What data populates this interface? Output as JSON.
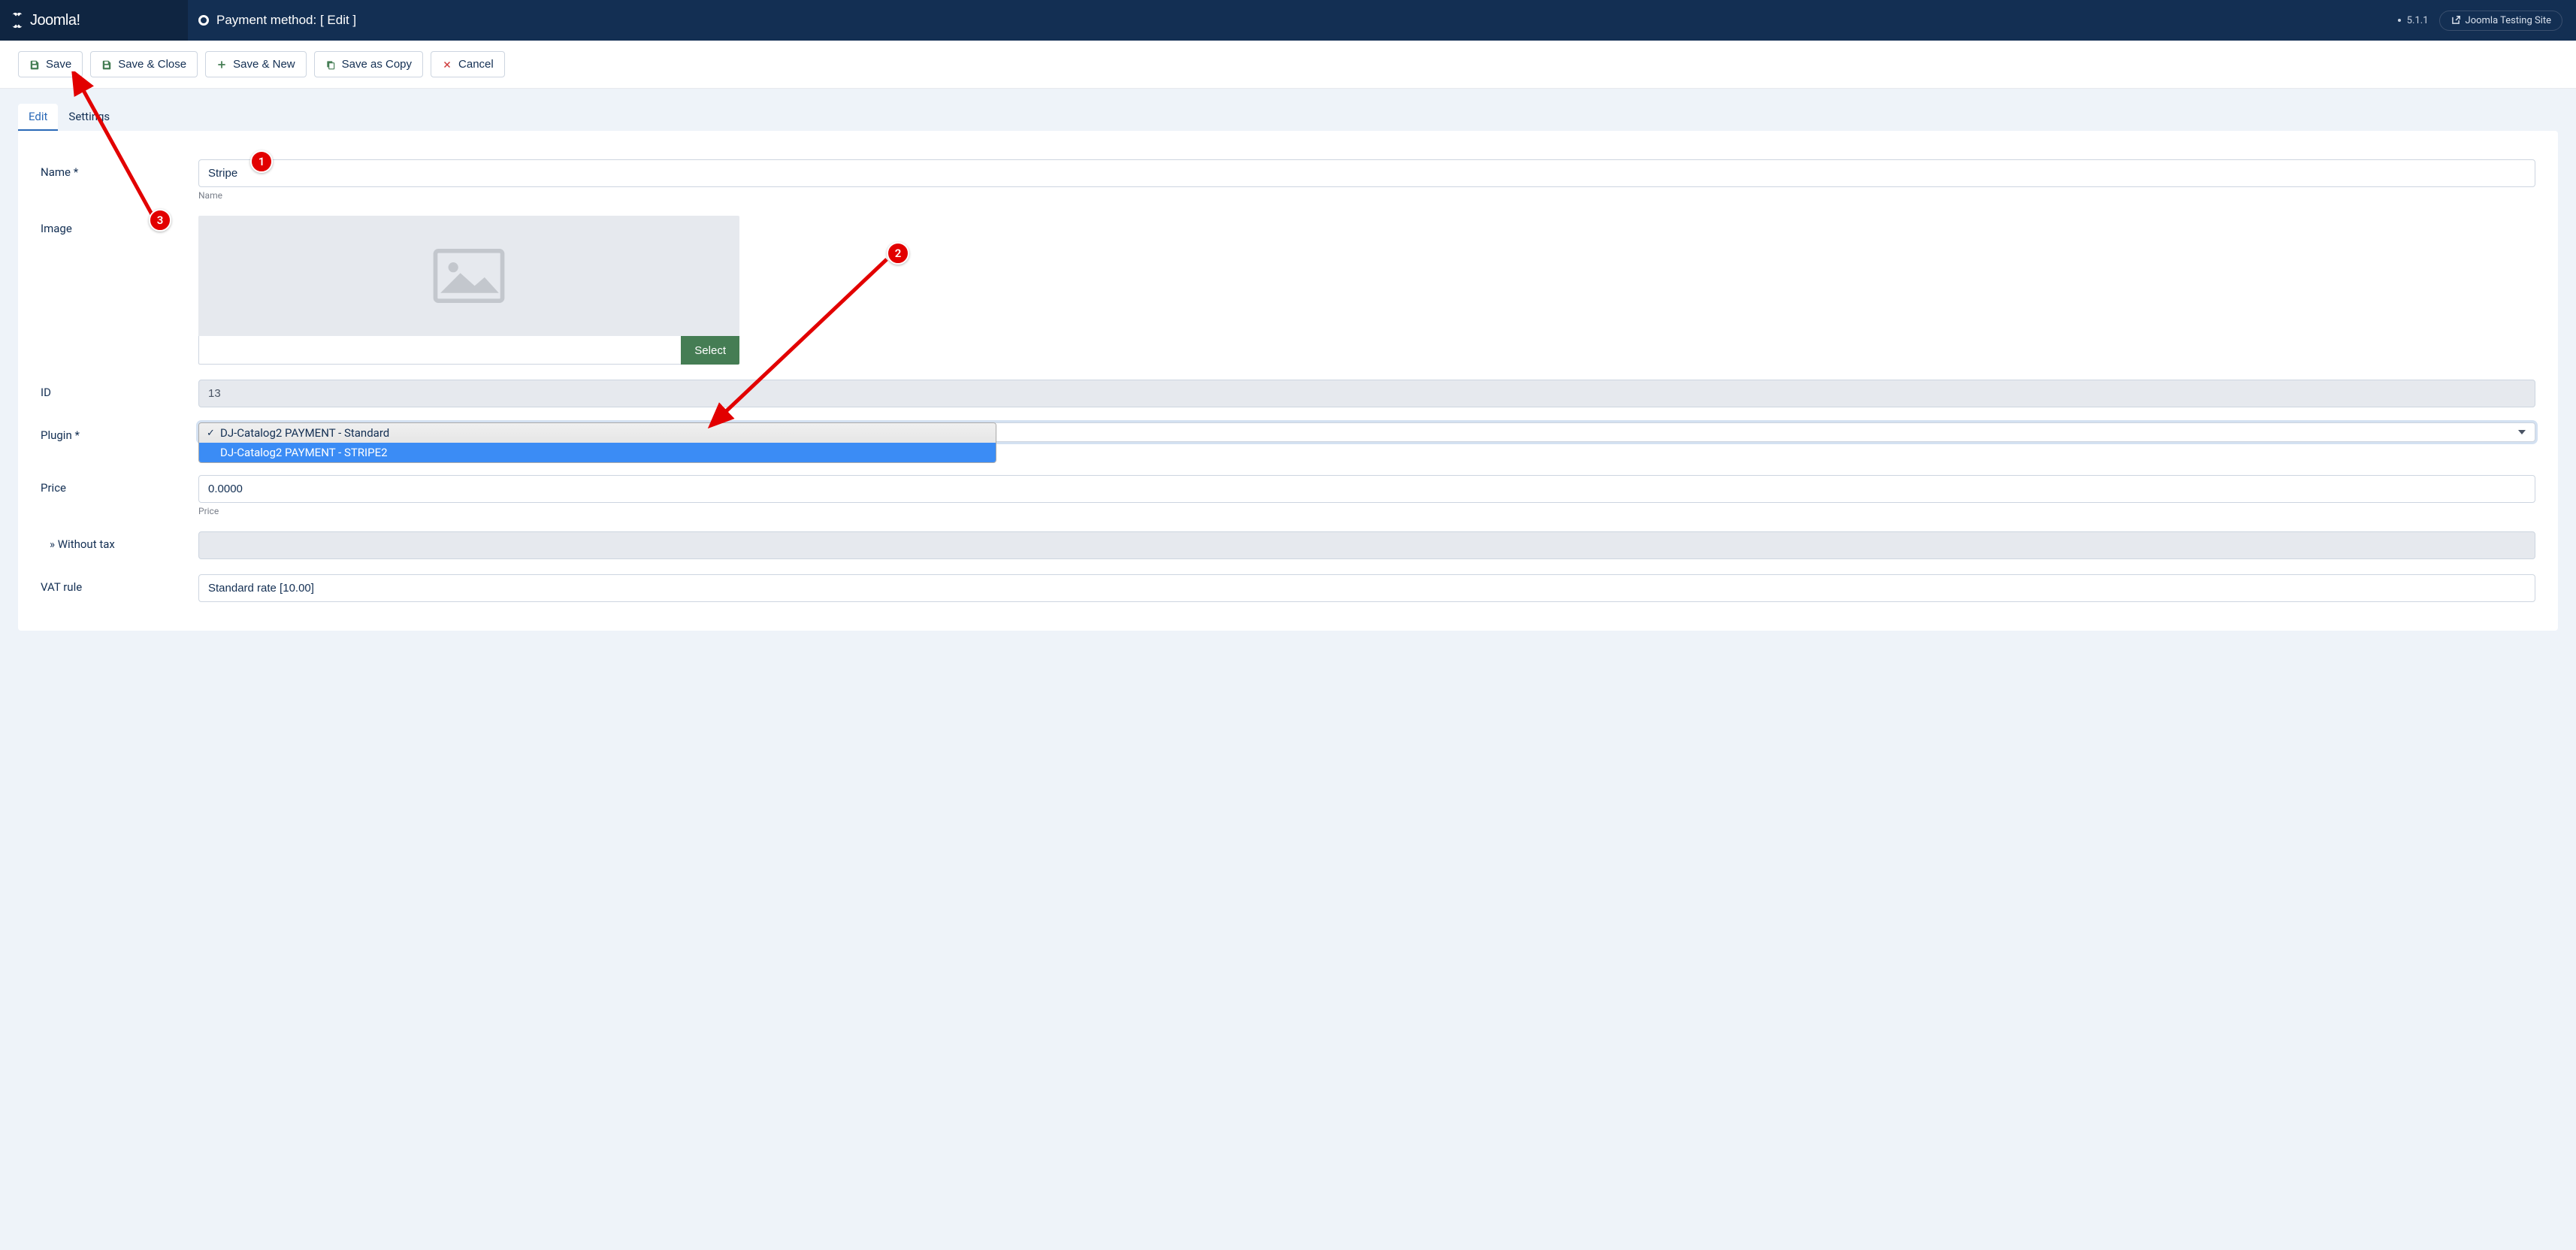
{
  "header": {
    "brand": "Joomla!",
    "page_title": "Payment method: [ Edit ]",
    "version": "5.1.1",
    "site_link_label": "Joomla Testing Site"
  },
  "toolbar": {
    "save": "Save",
    "save_close": "Save & Close",
    "save_new": "Save & New",
    "save_copy": "Save as Copy",
    "cancel": "Cancel"
  },
  "tabs": {
    "edit": "Edit",
    "settings": "Settings"
  },
  "form": {
    "name_label": "Name *",
    "name_value": "Stripe",
    "name_helper": "Name",
    "image_label": "Image",
    "image_select_btn": "Select",
    "id_label": "ID",
    "id_value": "13",
    "plugin_label": "Plugin *",
    "plugin_options": [
      {
        "label": "DJ-Catalog2 PAYMENT - Standard",
        "selected": true
      },
      {
        "label": "DJ-Catalog2 PAYMENT - STRIPE2",
        "highlighted": true
      }
    ],
    "price_label": "Price",
    "price_value": "0.0000",
    "price_helper": "Price",
    "without_tax_label": "» Without tax",
    "without_tax_value": "",
    "vat_label": "VAT rule",
    "vat_value": "Standard rate [10.00]"
  },
  "annotations": {
    "m1": "1",
    "m2": "2",
    "m3": "3"
  }
}
